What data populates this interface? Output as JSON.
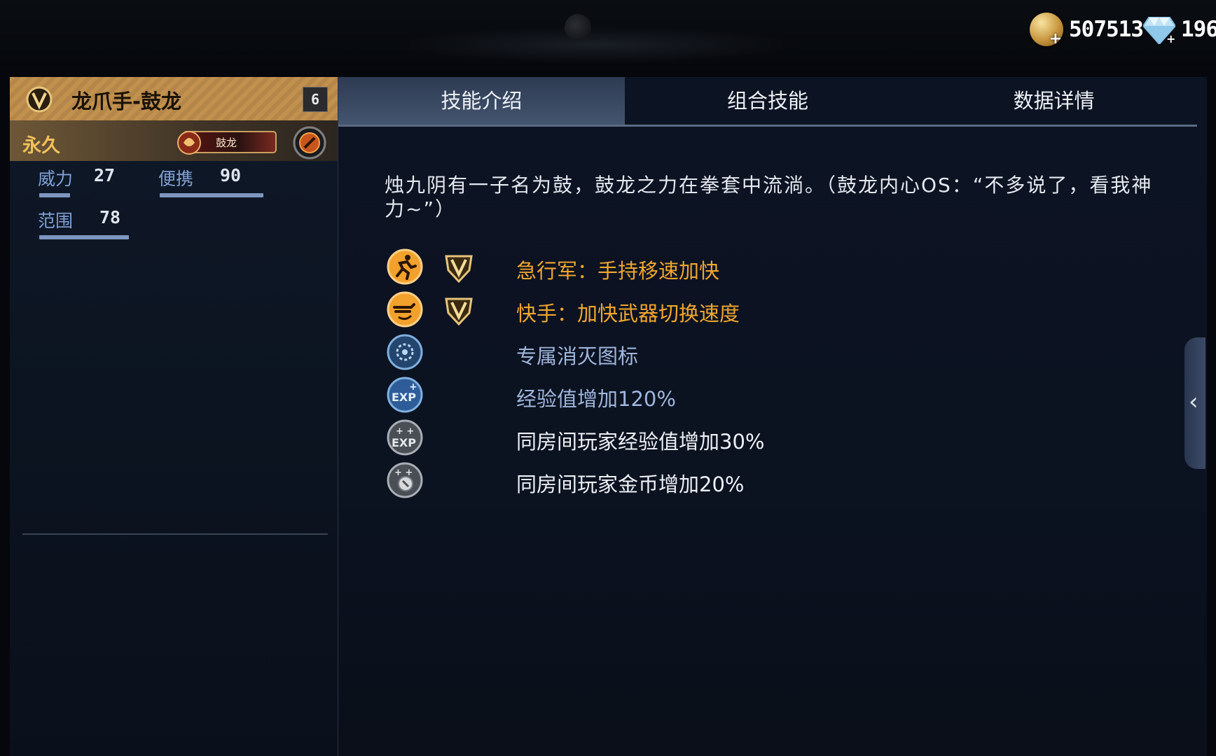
{
  "currency": {
    "gold": "507513",
    "diamond": "196"
  },
  "weapon": {
    "name": "龙爪手-鼓龙",
    "level": "6",
    "duration": "永久",
    "name_tag": "鼓龙"
  },
  "stats": [
    {
      "label": "威力",
      "value": "27"
    },
    {
      "label": "便携",
      "value": "90"
    },
    {
      "label": "范围",
      "value": "78"
    }
  ],
  "tabs": [
    "技能介绍",
    "组合技能",
    "数据详情"
  ],
  "active_tab": "技能介绍",
  "description": "烛九阴有一子名为鼓，鼓龙之力在拳套中流淌。（鼓龙内心OS：“不多说了，看我神力~”）",
  "skills": [
    {
      "icon": "running-man-icon",
      "vip": true,
      "text": "急行军：手持移速加快",
      "color": "#f0a630"
    },
    {
      "icon": "weapon-swap-icon",
      "vip": true,
      "text": "快手：加快武器切换速度",
      "color": "#f0a630"
    },
    {
      "icon": "kill-icon",
      "vip": false,
      "text": "专属消灭图标",
      "color": "#9fb6dc"
    },
    {
      "icon": "exp-icon",
      "vip": false,
      "text": "经验值增加120%",
      "color": "#9fb6dc"
    },
    {
      "icon": "room-exp-icon",
      "vip": false,
      "text": "同房间玩家经验值增加30%",
      "color": "#eef1f6"
    },
    {
      "icon": "room-gold-icon",
      "vip": false,
      "text": "同房间玩家金币增加20%",
      "color": "#eef1f6"
    }
  ],
  "colors": {
    "accent_gold": "#f0a630",
    "stat_label": "#7fa0d6",
    "tab_active": "#44556f"
  }
}
